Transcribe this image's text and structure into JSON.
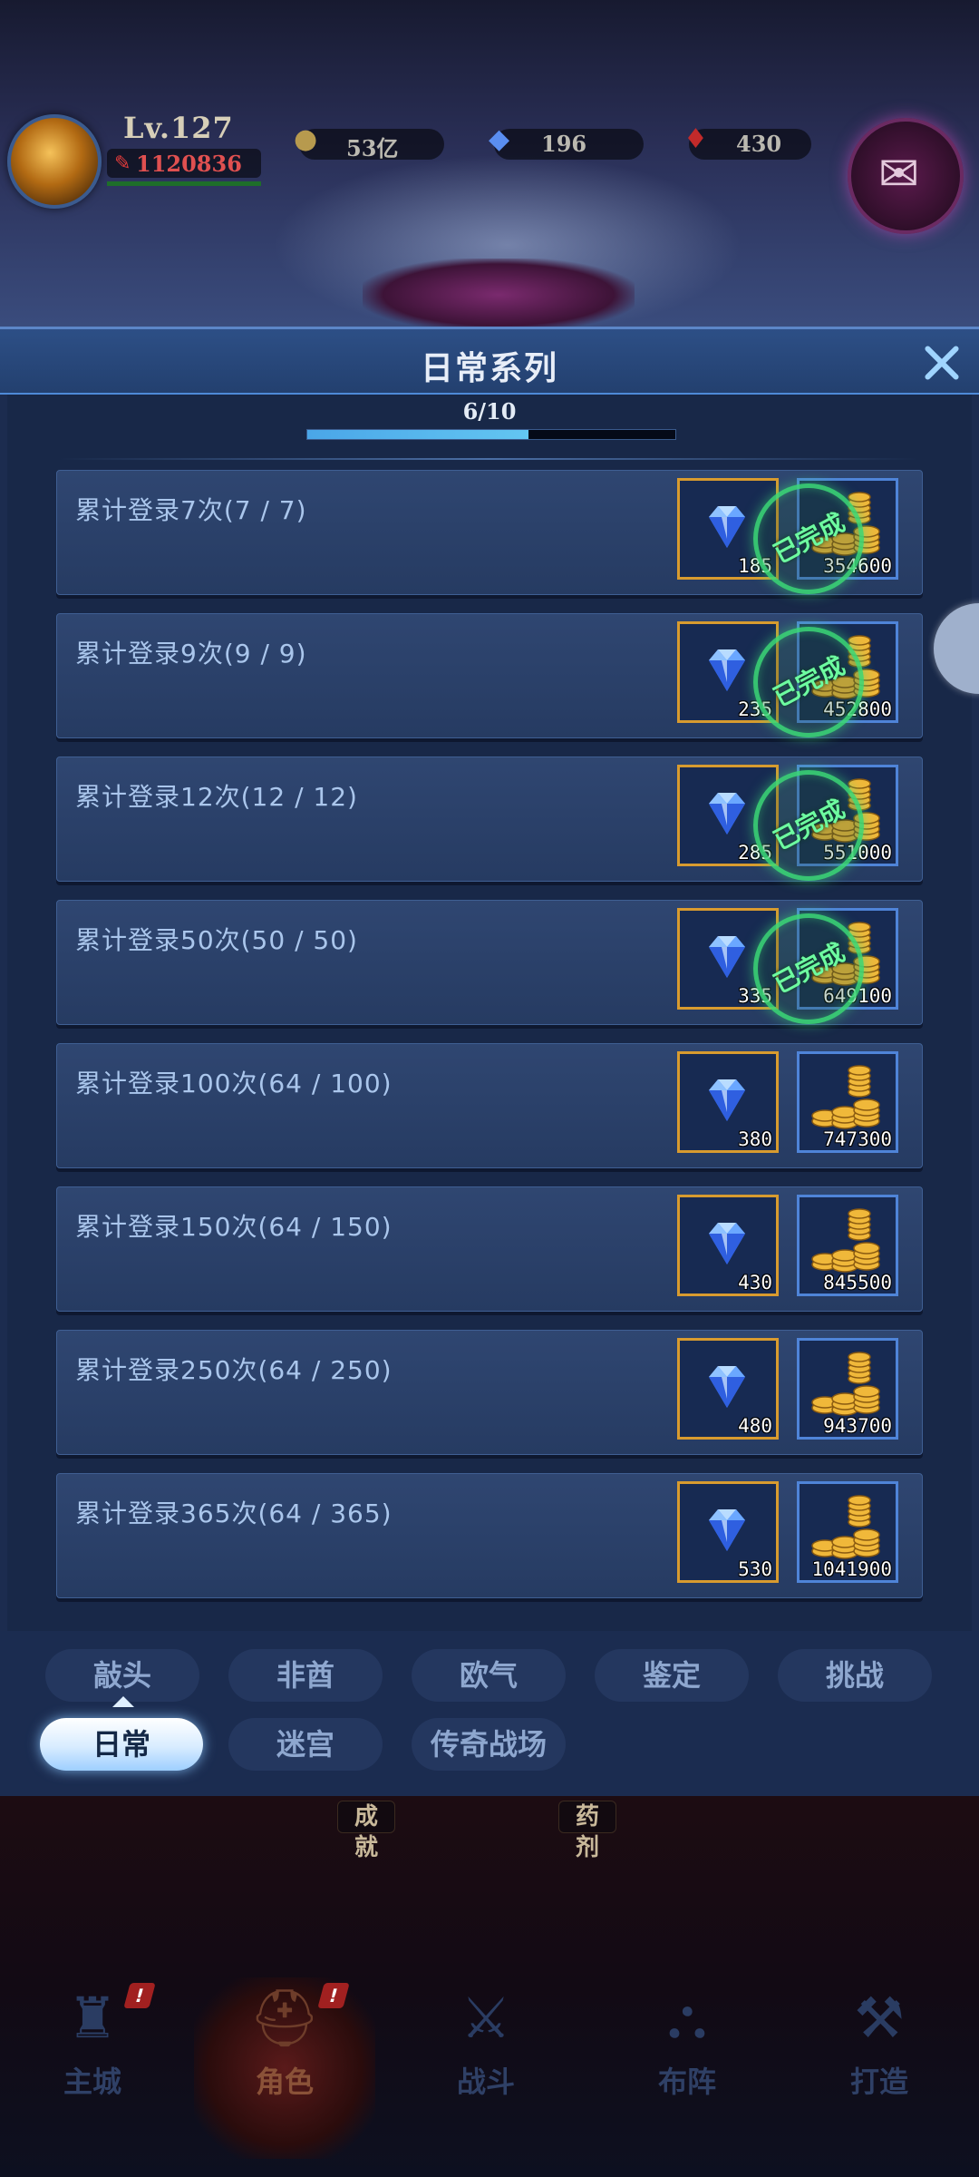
{
  "hud": {
    "level": "Lv.127",
    "power": "1120836",
    "resources": [
      {
        "icon": "gold-coin-icon",
        "value": "53亿"
      },
      {
        "icon": "diamond-icon",
        "value": "196"
      },
      {
        "icon": "red-gem-icon",
        "value": "430"
      }
    ]
  },
  "panel": {
    "title": "日常系列",
    "progress_text": "6/10",
    "progress": 0.6
  },
  "rows": [
    {
      "label": "累计登录7次(7 / 7)",
      "gem": "185",
      "gold": "354600",
      "completed": true
    },
    {
      "label": "累计登录9次(9 / 9)",
      "gem": "235",
      "gold": "452800",
      "completed": true
    },
    {
      "label": "累计登录12次(12 / 12)",
      "gem": "285",
      "gold": "551000",
      "completed": true
    },
    {
      "label": "累计登录50次(50 / 50)",
      "gem": "335",
      "gold": "649100",
      "completed": true
    },
    {
      "label": "累计登录100次(64 / 100)",
      "gem": "380",
      "gold": "747300",
      "completed": false
    },
    {
      "label": "累计登录150次(64 / 150)",
      "gem": "430",
      "gold": "845500",
      "completed": false
    },
    {
      "label": "累计登录250次(64 / 250)",
      "gem": "480",
      "gold": "943700",
      "completed": false
    },
    {
      "label": "累计登录365次(64 / 365)",
      "gem": "530",
      "gold": "1041900",
      "completed": false
    }
  ],
  "stamp_text": "已完成",
  "categories": {
    "row1": [
      "敲头",
      "非酋",
      "欧气",
      "鉴定",
      "挑战"
    ],
    "row2": [
      "日常",
      "迷宫",
      "传奇战场"
    ],
    "active": "日常"
  },
  "mid_labels": [
    "成就",
    "药剂"
  ],
  "bottom_nav": [
    {
      "label": "主城",
      "icon": "castle-icon",
      "badge": "!"
    },
    {
      "label": "角色",
      "icon": "helmet-icon",
      "badge": "!"
    },
    {
      "label": "战斗",
      "icon": "crossed-swords-icon"
    },
    {
      "label": "布阵",
      "icon": "formation-icon"
    },
    {
      "label": "打造",
      "icon": "anvil-icon"
    }
  ],
  "colors": {
    "accent": "#4aa6e8",
    "completed_stamp": "#6dfba0",
    "gem_frame": "#d89b2f",
    "gold_frame": "#4f84d8"
  }
}
